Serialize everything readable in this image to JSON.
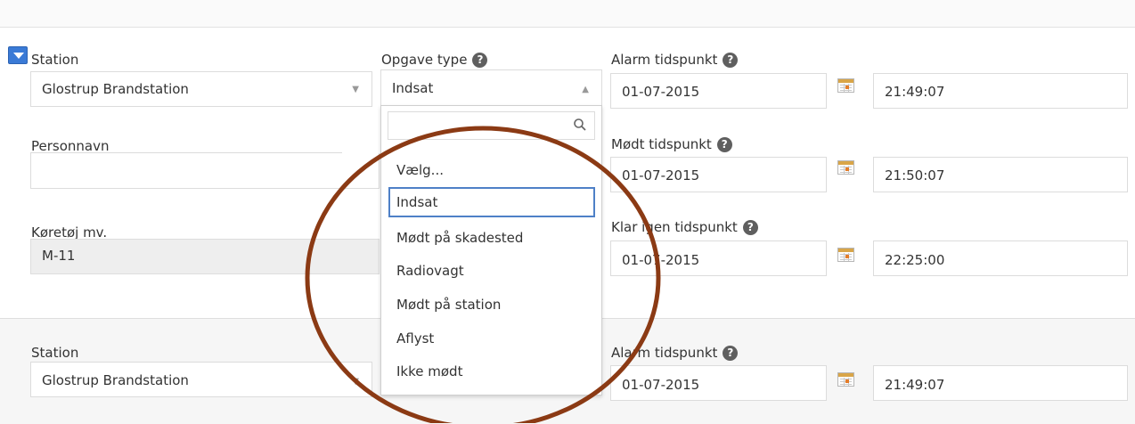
{
  "section1": {
    "station": {
      "label": "Station",
      "value": "Glostrup Brandstation"
    },
    "opgave_type": {
      "label": "Opgave type",
      "value": "Indsat",
      "help": "?"
    },
    "personnavn": {
      "label": "Personnavn",
      "value": ""
    },
    "koretoj": {
      "label": "Køretøj mv.",
      "value": "M-11"
    },
    "alarm": {
      "label": "Alarm tidspunkt",
      "help": "?",
      "date": "01-07-2015",
      "time": "21:49:07"
    },
    "modt": {
      "label": "Mødt tidspunkt",
      "help": "?",
      "date": "01-07-2015",
      "time": "21:50:07"
    },
    "klar": {
      "label": "Klar igen tidspunkt",
      "help": "?",
      "date": "01-07-2015",
      "time": "22:25:00"
    }
  },
  "section2": {
    "station": {
      "label": "Station",
      "value": "Glostrup Brandstation"
    },
    "alarm": {
      "label": "Alarm tidspunkt",
      "help": "?",
      "date": "01-07-2015",
      "time": "21:49:07"
    }
  },
  "dropdown": {
    "search_value": "",
    "options": [
      "Vælg...",
      "Indsat",
      "Mødt på skadested",
      "Radiovagt",
      "Mødt på station",
      "Aflyst",
      "Ikke mødt"
    ],
    "selected": "Indsat"
  },
  "colors": {
    "annotation_circle": "#8b3a14",
    "selected_outline": "#4e80c7",
    "collapse_button": "#3a7ad6"
  }
}
